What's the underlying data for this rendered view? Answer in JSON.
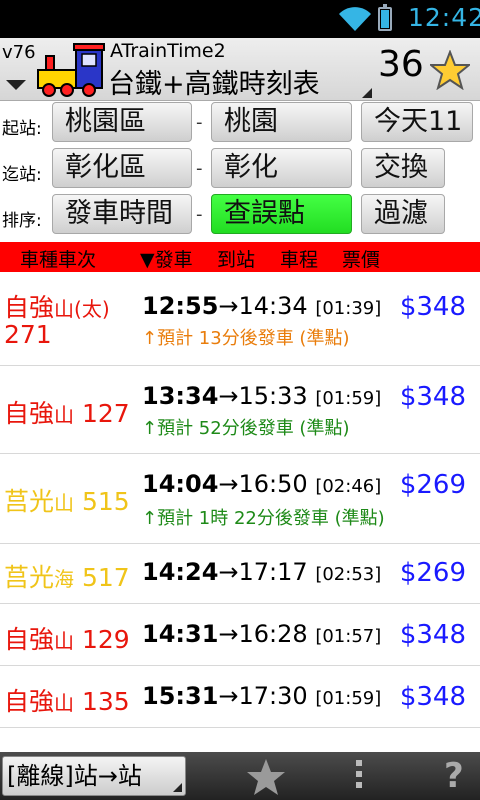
{
  "status_bar": {
    "time": "12:42"
  },
  "app": {
    "version": "v76",
    "name": "ATrainTime2",
    "title": "台鐵+高鐵時刻表",
    "count": "36"
  },
  "controls": {
    "from_label": "起站:",
    "from_region": "桃園區",
    "from_station": "桃園",
    "date_button": "今天11",
    "to_label": "迄站:",
    "to_region": "彰化區",
    "to_station": "彰化",
    "swap_button": "交換",
    "sort_label": "排序:",
    "sort_button": "發車時間",
    "delay_button": "查誤點",
    "filter_button": "過濾",
    "dash": "-"
  },
  "table_header": {
    "train": "車種車次",
    "depart": "▼發車",
    "arrive": "到站",
    "duration": "車程",
    "fare": "票價"
  },
  "trains": [
    {
      "type": "自強",
      "line": "山(太)",
      "number": "271",
      "depart": "12:55",
      "arrow": "→",
      "arrive": "14:34",
      "duration": "[01:39]",
      "price": "$348",
      "status": "↑預計 13分後發車 (準點)"
    },
    {
      "type": "自強",
      "line": "山",
      "number": "127",
      "depart": "13:34",
      "arrow": "→",
      "arrive": "15:33",
      "duration": "[01:59]",
      "price": "$348",
      "status": "↑預計 52分後發車 (準點)"
    },
    {
      "type": "莒光",
      "line": "山",
      "number": "515",
      "depart": "14:04",
      "arrow": "→",
      "arrive": "16:50",
      "duration": "[02:46]",
      "price": "$269",
      "status": "↑預計 1時 22分後發車 (準點)"
    },
    {
      "type": "莒光",
      "line": "海",
      "number": "517",
      "depart": "14:24",
      "arrow": "→",
      "arrive": "17:17",
      "duration": "[02:53]",
      "price": "$269"
    },
    {
      "type": "自強",
      "line": "山",
      "number": "129",
      "depart": "14:31",
      "arrow": "→",
      "arrive": "16:28",
      "duration": "[01:57]",
      "price": "$348"
    },
    {
      "type": "自強",
      "line": "山",
      "number": "135",
      "depart": "15:31",
      "arrow": "→",
      "arrive": "17:30",
      "duration": "[01:59]",
      "price": "$348"
    }
  ],
  "bottom_bar": {
    "offline_button": "[離線]站→站",
    "help": "?"
  },
  "colors": {
    "header_bg": "#ff0000",
    "tze_chiang": "#e8160c",
    "chu_kuang": "#f0c419",
    "price": "#1a1aff",
    "status_soon": "#e97d0c",
    "status_later": "#1e8a18",
    "clock": "#35b5e5"
  }
}
